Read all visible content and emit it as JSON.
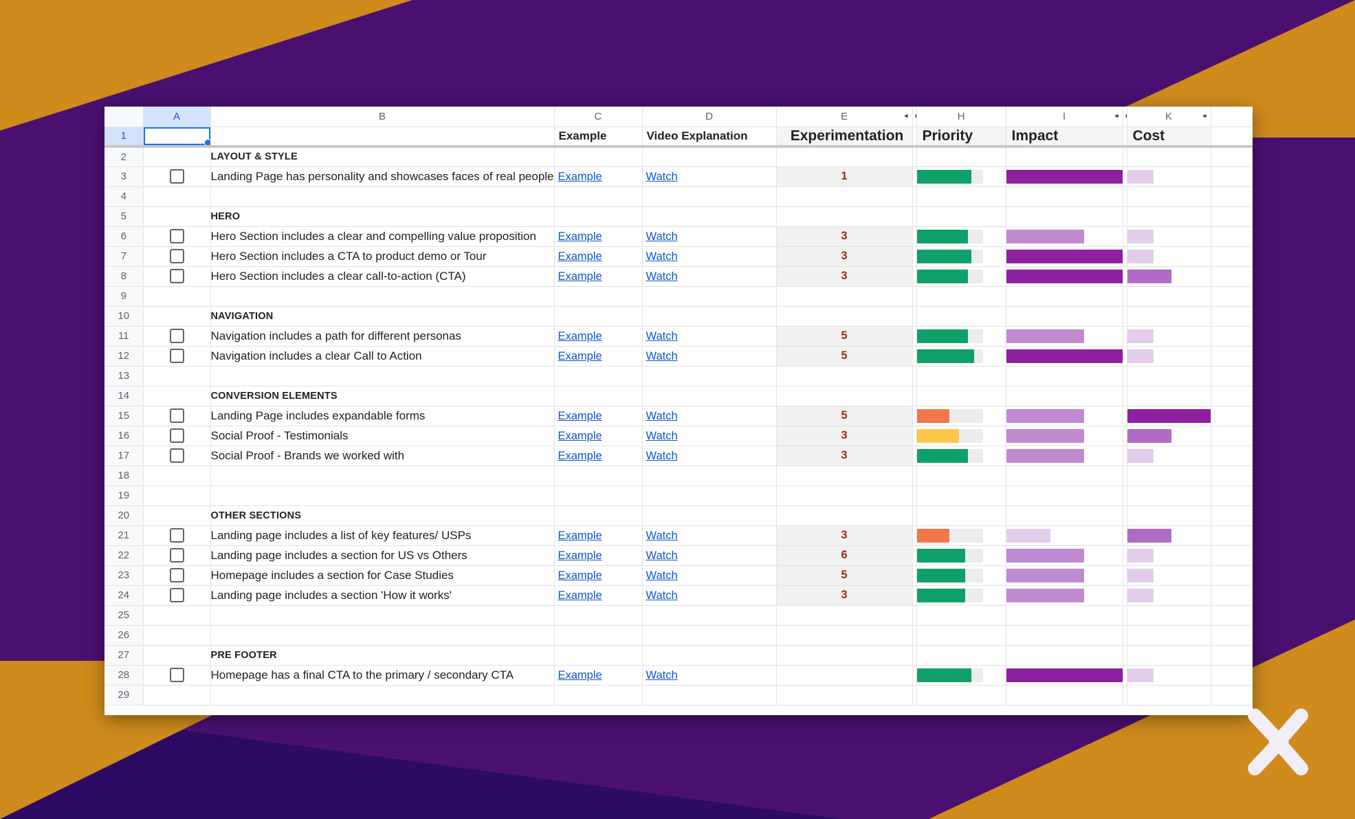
{
  "theme": {
    "bg_purple": "#4a1070",
    "bg_purple_dark": "#2d0a63",
    "bg_gold": "#cf8c1d",
    "link_blue": "#1155cc",
    "selection_blue": "#1a73e8",
    "green": "#0fa06a",
    "orange": "#f2784b",
    "yellow": "#fbc748",
    "purple_bar": "#8e1fa0",
    "purple_bar_mid": "#b06cc4",
    "purple_bar_light": "#e4cdeb"
  },
  "logo": {
    "name": "x-logo",
    "alt": "X logo"
  },
  "spreadsheet": {
    "column_letters": [
      "A",
      "B",
      "C",
      "D",
      "E",
      "H",
      "I",
      "K"
    ],
    "hidden_column_markers": [
      {
        "after": "E",
        "left_arrow": "◂",
        "right_arrow": "▸"
      },
      {
        "after": "I",
        "left_arrow": "◂",
        "right_arrow": "▸"
      }
    ],
    "selected_cell": "A1",
    "header_row": {
      "row_number": "1",
      "a": "",
      "b": "",
      "c": "Example",
      "d": "Video Explanation",
      "e": "Experimentation",
      "h": "Priority",
      "i": "Impact",
      "k": "Cost"
    },
    "rows": [
      {
        "n": "2",
        "type": "section",
        "checkbox": false,
        "b": "LAYOUT & STYLE",
        "c": "",
        "d": "",
        "e": "",
        "priority": null,
        "impact": null,
        "cost": null
      },
      {
        "n": "3",
        "type": "item",
        "checkbox": true,
        "b": "Landing Page has personality and showcases faces of real people",
        "c": "Example",
        "d": "Watch",
        "e": "1",
        "priority": {
          "value": 62,
          "color": "#0fa06a"
        },
        "impact": {
          "value": 100,
          "color": "#8e1fa0"
        },
        "cost": {
          "value": 32,
          "color": "#e4cdeb"
        }
      },
      {
        "n": "4",
        "type": "blank",
        "checkbox": false,
        "b": "",
        "c": "",
        "d": "",
        "e": "",
        "priority": null,
        "impact": null,
        "cost": null
      },
      {
        "n": "5",
        "type": "section",
        "checkbox": false,
        "b": "HERO",
        "c": "",
        "d": "",
        "e": "",
        "priority": null,
        "impact": null,
        "cost": null
      },
      {
        "n": "6",
        "type": "item",
        "checkbox": true,
        "b": "Hero Section includes a clear and compelling value proposition",
        "c": "Example",
        "d": "Watch",
        "e": "3",
        "priority": {
          "value": 58,
          "color": "#0fa06a"
        },
        "impact": {
          "value": 67,
          "color": "#c08ad1"
        },
        "cost": {
          "value": 32,
          "color": "#e4cdeb"
        }
      },
      {
        "n": "7",
        "type": "item",
        "checkbox": true,
        "b": "Hero Section includes a CTA to product demo or Tour",
        "c": "Example",
        "d": "Watch",
        "e": "3",
        "priority": {
          "value": 62,
          "color": "#0fa06a"
        },
        "impact": {
          "value": 100,
          "color": "#8e1fa0"
        },
        "cost": {
          "value": 32,
          "color": "#e4cdeb"
        }
      },
      {
        "n": "8",
        "type": "item",
        "checkbox": true,
        "b": "Hero Section includes a clear call-to-action (CTA)",
        "c": "Example",
        "d": "Watch",
        "e": "3",
        "priority": {
          "value": 58,
          "color": "#0fa06a"
        },
        "impact": {
          "value": 100,
          "color": "#8e1fa0"
        },
        "cost": {
          "value": 53,
          "color": "#b06cc4"
        }
      },
      {
        "n": "9",
        "type": "blank",
        "checkbox": false,
        "b": "",
        "c": "",
        "d": "",
        "e": "",
        "priority": null,
        "impact": null,
        "cost": null
      },
      {
        "n": "10",
        "type": "section",
        "checkbox": false,
        "b": "NAVIGATION",
        "c": "",
        "d": "",
        "e": "",
        "priority": null,
        "impact": null,
        "cost": null
      },
      {
        "n": "11",
        "type": "item",
        "checkbox": true,
        "b": "Navigation includes a path for different personas",
        "c": "Example",
        "d": "Watch",
        "e": "5",
        "priority": {
          "value": 58,
          "color": "#0fa06a"
        },
        "impact": {
          "value": 67,
          "color": "#c08ad1"
        },
        "cost": {
          "value": 32,
          "color": "#e4cdeb"
        }
      },
      {
        "n": "12",
        "type": "item",
        "checkbox": true,
        "b": "Navigation includes a clear Call to Action",
        "c": "Example",
        "d": "Watch",
        "e": "5",
        "priority": {
          "value": 65,
          "color": "#0fa06a"
        },
        "impact": {
          "value": 100,
          "color": "#8e1fa0"
        },
        "cost": {
          "value": 32,
          "color": "#e4cdeb"
        }
      },
      {
        "n": "13",
        "type": "blank",
        "checkbox": false,
        "b": "",
        "c": "",
        "d": "",
        "e": "",
        "priority": null,
        "impact": null,
        "cost": null
      },
      {
        "n": "14",
        "type": "section",
        "checkbox": false,
        "b": "CONVERSION ELEMENTS",
        "c": "",
        "d": "",
        "e": "",
        "priority": null,
        "impact": null,
        "cost": null
      },
      {
        "n": "15",
        "type": "item",
        "checkbox": true,
        "b": "Landing Page includes expandable forms",
        "c": "Example",
        "d": "Watch",
        "e": "5",
        "priority": {
          "value": 37,
          "color": "#f2784b"
        },
        "impact": {
          "value": 67,
          "color": "#c08ad1"
        },
        "cost": {
          "value": 100,
          "color": "#8e1fa0"
        }
      },
      {
        "n": "16",
        "type": "item",
        "checkbox": true,
        "b": "Social Proof - Testimonials",
        "c": "Example",
        "d": "Watch",
        "e": "3",
        "priority": {
          "value": 48,
          "color": "#fbc748"
        },
        "impact": {
          "value": 67,
          "color": "#c08ad1"
        },
        "cost": {
          "value": 53,
          "color": "#b06cc4"
        }
      },
      {
        "n": "17",
        "type": "item",
        "checkbox": true,
        "b": "Social Proof - Brands we worked with",
        "c": "Example",
        "d": "Watch",
        "e": "3",
        "priority": {
          "value": 58,
          "color": "#0fa06a"
        },
        "impact": {
          "value": 67,
          "color": "#c08ad1"
        },
        "cost": {
          "value": 32,
          "color": "#e4cdeb"
        }
      },
      {
        "n": "18",
        "type": "blank",
        "checkbox": false,
        "b": "",
        "c": "",
        "d": "",
        "e": "",
        "priority": null,
        "impact": null,
        "cost": null
      },
      {
        "n": "19",
        "type": "blank",
        "checkbox": false,
        "b": "",
        "c": "",
        "d": "",
        "e": "",
        "priority": null,
        "impact": null,
        "cost": null
      },
      {
        "n": "20",
        "type": "section",
        "checkbox": false,
        "b": "OTHER SECTIONS",
        "c": "",
        "d": "",
        "e": "",
        "priority": null,
        "impact": null,
        "cost": null
      },
      {
        "n": "21",
        "type": "item",
        "checkbox": true,
        "b": "Landing page includes a list of key features/ USPs",
        "c": "Example",
        "d": "Watch",
        "e": "3",
        "priority": {
          "value": 37,
          "color": "#f2784b"
        },
        "impact": {
          "value": 38,
          "color": "#e4cdeb"
        },
        "cost": {
          "value": 53,
          "color": "#b06cc4"
        }
      },
      {
        "n": "22",
        "type": "item",
        "checkbox": true,
        "b": "Landing page includes a section for US vs Others",
        "c": "Example",
        "d": "Watch",
        "e": "6",
        "priority": {
          "value": 55,
          "color": "#0fa06a"
        },
        "impact": {
          "value": 67,
          "color": "#c08ad1"
        },
        "cost": {
          "value": 32,
          "color": "#e4cdeb"
        }
      },
      {
        "n": "23",
        "type": "item",
        "checkbox": true,
        "b": "Homepage includes a section for Case Studies",
        "c": "Example",
        "d": "Watch",
        "e": "5",
        "priority": {
          "value": 55,
          "color": "#0fa06a"
        },
        "impact": {
          "value": 67,
          "color": "#c08ad1"
        },
        "cost": {
          "value": 32,
          "color": "#e4cdeb"
        }
      },
      {
        "n": "24",
        "type": "item",
        "checkbox": true,
        "b": "Landing page includes a section 'How it works'",
        "c": "Example",
        "d": "Watch",
        "e": "3",
        "priority": {
          "value": 55,
          "color": "#0fa06a"
        },
        "impact": {
          "value": 67,
          "color": "#c08ad1"
        },
        "cost": {
          "value": 32,
          "color": "#e4cdeb"
        }
      },
      {
        "n": "25",
        "type": "blank",
        "checkbox": false,
        "b": "",
        "c": "",
        "d": "",
        "e": "",
        "priority": null,
        "impact": null,
        "cost": null
      },
      {
        "n": "26",
        "type": "blank",
        "checkbox": false,
        "b": "",
        "c": "",
        "d": "",
        "e": "",
        "priority": null,
        "impact": null,
        "cost": null
      },
      {
        "n": "27",
        "type": "section",
        "checkbox": false,
        "b": "PRE FOOTER",
        "c": "",
        "d": "",
        "e": "",
        "priority": null,
        "impact": null,
        "cost": null
      },
      {
        "n": "28",
        "type": "item",
        "checkbox": true,
        "b": "Homepage has a final CTA to the primary / secondary CTA",
        "c": "Example",
        "d": "Watch",
        "e": "",
        "priority": {
          "value": 62,
          "color": "#0fa06a"
        },
        "impact": {
          "value": 100,
          "color": "#8e1fa0"
        },
        "cost": {
          "value": 32,
          "color": "#e4cdeb"
        }
      },
      {
        "n": "29",
        "type": "blank",
        "checkbox": false,
        "b": "",
        "c": "",
        "d": "",
        "e": "",
        "priority": null,
        "impact": null,
        "cost": null
      }
    ]
  }
}
